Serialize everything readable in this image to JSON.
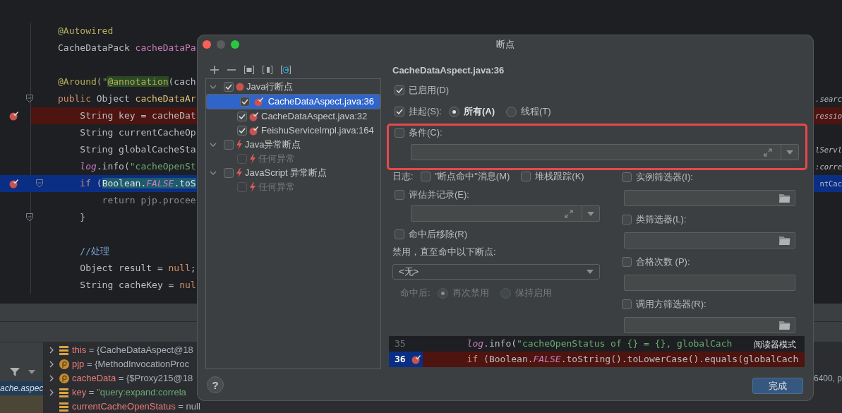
{
  "editor": {
    "lines": [
      {
        "kind": "code",
        "breakpoint": false,
        "current": false,
        "fold": false,
        "tokens": [
          {
            "text": "@Autowired",
            "kind": "annotation"
          }
        ]
      },
      {
        "kind": "code",
        "breakpoint": false,
        "current": false,
        "fold": false,
        "tokens": [
          {
            "text": "CacheDataPack ",
            "kind": "plain"
          },
          {
            "text": "cacheDataPa",
            "kind": "field"
          }
        ]
      },
      {
        "kind": "blank",
        "breakpoint": false,
        "current": false,
        "fold": false
      },
      {
        "kind": "code",
        "breakpoint": false,
        "current": false,
        "fold": false,
        "tokens": [
          {
            "text": "@Around(",
            "kind": "annotation"
          },
          {
            "text": "\"",
            "kind": "string"
          },
          {
            "text": "@annotation",
            "kind": "annotation-hl"
          },
          {
            "text": "(cach",
            "kind": "plain"
          }
        ]
      },
      {
        "kind": "code",
        "breakpoint": false,
        "current": false,
        "fold": true,
        "tokens": [
          {
            "text": "public ",
            "kind": "keyword"
          },
          {
            "text": "Object ",
            "kind": "plain"
          },
          {
            "text": "cacheDataAr",
            "kind": "method"
          }
        ],
        "tail": {
          "text": ".searc",
          "kind": "italic"
        }
      },
      {
        "kind": "code",
        "breakpoint": true,
        "current": false,
        "fold": false,
        "tokens": [
          {
            "text": "    String key = cacheDat",
            "kind": "plain"
          }
        ],
        "tail": {
          "text": "ressio",
          "kind": "italic"
        }
      },
      {
        "kind": "code",
        "breakpoint": false,
        "current": false,
        "fold": false,
        "tokens": [
          {
            "text": "    String currentCacheOp",
            "kind": "plain"
          }
        ]
      },
      {
        "kind": "code",
        "breakpoint": false,
        "current": false,
        "fold": false,
        "tokens": [
          {
            "text": "    String globalCacheSta",
            "kind": "plain"
          }
        ],
        "tail": {
          "text": "lServl",
          "kind": "italic"
        }
      },
      {
        "kind": "code",
        "breakpoint": false,
        "current": false,
        "fold": false,
        "tokens": [
          {
            "text": "    log",
            "kind": "static"
          },
          {
            "text": ".info(",
            "kind": "plain"
          },
          {
            "text": "\"cacheOpenSt",
            "kind": "string"
          }
        ],
        "tail": {
          "text": ":corre",
          "kind": "italic"
        }
      },
      {
        "kind": "code",
        "breakpoint": true,
        "current": true,
        "fold": true,
        "tokens": [
          {
            "text": "    if ",
            "kind": "keyword"
          },
          {
            "text": "(",
            "kind": "plain"
          },
          {
            "text": "Boolean.",
            "kind": "sel"
          },
          {
            "text": "FALSE",
            "kind": "sel-static"
          },
          {
            "text": ".toS",
            "kind": "sel"
          }
        ],
        "tail": {
          "text": "ntCac",
          "kind": "plain"
        }
      },
      {
        "kind": "code",
        "breakpoint": false,
        "current": false,
        "fold": false,
        "tokens": [
          {
            "text": "        return pjp.procee",
            "kind": "faded"
          }
        ]
      },
      {
        "kind": "code",
        "breakpoint": false,
        "current": false,
        "fold": true,
        "tokens": [
          {
            "text": "    }",
            "kind": "plain"
          }
        ]
      },
      {
        "kind": "blank",
        "breakpoint": false,
        "current": false,
        "fold": false
      },
      {
        "kind": "code",
        "breakpoint": false,
        "current": false,
        "fold": false,
        "tokens": [
          {
            "text": "    //处理",
            "kind": "comment"
          }
        ]
      },
      {
        "kind": "code",
        "breakpoint": false,
        "current": false,
        "fold": false,
        "tokens": [
          {
            "text": "    Object result = ",
            "kind": "plain"
          },
          {
            "text": "null",
            "kind": "keyword"
          },
          {
            "text": ";",
            "kind": "plain"
          }
        ]
      },
      {
        "kind": "code",
        "breakpoint": false,
        "current": false,
        "fold": false,
        "tokens": [
          {
            "text": "    String cacheKey = ",
            "kind": "plain"
          },
          {
            "text": "nul",
            "kind": "keyword"
          }
        ]
      }
    ]
  },
  "debug": {
    "frames": [
      {
        "text": "ache.aspec",
        "selected": true
      }
    ],
    "variables": [
      {
        "kind": "field",
        "expandable": true,
        "string": false,
        "name": "this",
        "separator": "=",
        "value": "{CacheDataAspect@18"
      },
      {
        "kind": "param",
        "expandable": true,
        "string": false,
        "name": "pjp",
        "separator": "=",
        "value": "{MethodInvocationProc"
      },
      {
        "kind": "param",
        "expandable": true,
        "string": false,
        "name": "cacheData",
        "separator": "=",
        "value": "{$Proxy215@18",
        "tail": "6400, p"
      },
      {
        "kind": "field",
        "expandable": true,
        "string": true,
        "name": "key",
        "separator": "=",
        "value": "\"query:expand:correla"
      },
      {
        "kind": "field",
        "expandable": false,
        "string": false,
        "name": "currentCacheOpenStatus",
        "separator": "=",
        "value": "null"
      }
    ]
  },
  "dialog": {
    "title": "断点",
    "tree": [
      {
        "kind": "line-group",
        "label": "Java行断点",
        "expanded": true,
        "checked": true,
        "selected": false,
        "disabled": false,
        "children": [
          {
            "kind": "line",
            "label": "CacheDataAspect.java:36",
            "checked": true,
            "selected": true,
            "disabled": false
          },
          {
            "kind": "line",
            "label": "CacheDataAspect.java:32",
            "checked": true,
            "selected": false,
            "disabled": false
          },
          {
            "kind": "line",
            "label": "FeishuServiceImpl.java:164",
            "checked": true,
            "selected": false,
            "disabled": false
          }
        ]
      },
      {
        "kind": "exception",
        "label": "Java异常断点",
        "expanded": true,
        "checked": false,
        "selected": false,
        "disabled": false,
        "children": [
          {
            "kind": "exception",
            "label": "任何异常",
            "checked": false,
            "selected": false,
            "disabled": true
          }
        ]
      },
      {
        "kind": "exception",
        "label": "JavaScript 异常断点",
        "expanded": true,
        "checked": false,
        "selected": false,
        "disabled": false,
        "children": [
          {
            "kind": "exception",
            "label": "任何异常",
            "checked": false,
            "selected": false,
            "disabled": true
          }
        ]
      }
    ],
    "details": {
      "title": "CacheDataAspect.java:36",
      "enabled": {
        "label": "已启用(D)",
        "checked": true
      },
      "suspend": {
        "label": "挂起(S):",
        "checked": true,
        "options": [
          {
            "label": "所有(A)",
            "selected": true
          },
          {
            "label": "线程(T)",
            "selected": false
          }
        ]
      },
      "condition": {
        "label": "条件(C):",
        "checked": false,
        "highlighted": true
      },
      "log": {
        "label": "日志:",
        "options": [
          {
            "label": "\"断点命中\"消息(M)",
            "checked": false
          },
          {
            "label": "堆栈跟踪(K)",
            "checked": false
          }
        ]
      },
      "evaluate": {
        "label": "评估并记录(E):",
        "checked": false
      },
      "remove_once_hit": {
        "label": "命中后移除(R)",
        "checked": false
      },
      "disable_until": {
        "label": "禁用，直至命中以下断点:",
        "value": "<无>"
      },
      "after_hit": {
        "label": "命中后:",
        "disabled": true,
        "options": [
          {
            "label": "再次禁用",
            "selected": true
          },
          {
            "label": "保持启用",
            "selected": false
          }
        ]
      },
      "filters": [
        {
          "label": "实例筛选器(I):",
          "checked": false,
          "browse": true
        },
        {
          "label": "类筛选器(L):",
          "checked": false,
          "browse": true
        },
        {
          "label": "合格次数 (P):",
          "checked": false,
          "browse": false
        },
        {
          "label": "调用方筛选器(R):",
          "checked": false,
          "browse": true
        }
      ]
    },
    "preview": {
      "lines": [
        {
          "number": "35",
          "current": false,
          "breakpoint": false,
          "tokens": [
            {
              "text": "        log",
              "kind": "static"
            },
            {
              "text": ".info(",
              "kind": "plain"
            },
            {
              "text": "\"cacheOpenStatus of {} = {}, globalCach",
              "kind": "string"
            }
          ]
        },
        {
          "number": "36",
          "current": true,
          "breakpoint": true,
          "tokens": [
            {
              "text": "        if ",
              "kind": "keyword"
            },
            {
              "text": "(Boolean.",
              "kind": "plain"
            },
            {
              "text": "FALSE",
              "kind": "static"
            },
            {
              "text": ".toString().toLowerCase().equals(globalCach",
              "kind": "plain"
            }
          ]
        }
      ],
      "tooltip": "阅读器模式"
    },
    "help": "?",
    "buttons": [
      "完成"
    ]
  }
}
